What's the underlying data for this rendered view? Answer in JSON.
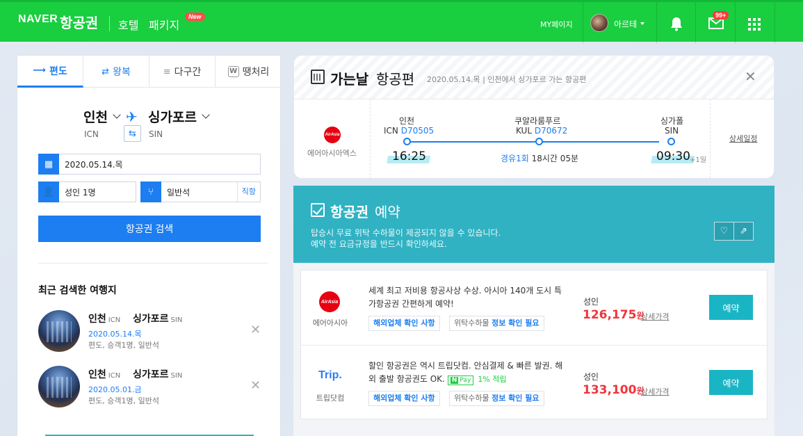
{
  "header": {
    "logo": "NAVER",
    "logo_sub": "항공권",
    "nav": [
      "호텔",
      "패키지"
    ],
    "new_badge": "New",
    "my_page": "MY페이지",
    "user_name": "아르테",
    "mail_badge": "99+"
  },
  "search": {
    "tabs": [
      "편도",
      "왕복",
      "다구간",
      "땡처리"
    ],
    "tab_icons": [
      "one-way-arrow-icon",
      "round-trip-arrow-icon",
      "multi-route-icon",
      "last-minute-icon"
    ],
    "from_city": "인천",
    "from_code": "ICN",
    "to_city": "싱가포르",
    "to_code": "SIN",
    "date": "2020.05.14.목",
    "passengers": "성인 1명",
    "seat_class": "일반석",
    "direct_label": "직항",
    "search_button": "항공권 검색",
    "w_icon_text": "W"
  },
  "recent": {
    "title": "최근 검색한 여행지",
    "items": [
      {
        "from": "인천",
        "from_code": "ICN",
        "to": "싱가포르",
        "to_code": "SIN",
        "date": "2020.05.14.목",
        "info": "편도, 승객1명, 일반석"
      },
      {
        "from": "인천",
        "from_code": "ICN",
        "to": "싱가포르",
        "to_code": "SIN",
        "date": "2020.05.01.금",
        "info": "편도, 승객1명, 일반석"
      }
    ]
  },
  "flight_card": {
    "title_bold": "가는날",
    "title_rest": "항공편",
    "subtitle": "2020.05.14.목 | 인천에서 싱가포르 가는 항공편",
    "airline_logo": "AirAsia",
    "airline": "에어아시아엑스",
    "origin": {
      "city": "인천",
      "code": "ICN",
      "flight": "D70505",
      "time": "16:25"
    },
    "transit": {
      "city": "쿠알라룸푸르",
      "code": "KUL",
      "flight": "D70672"
    },
    "destination": {
      "city": "싱가폴",
      "code": "SIN",
      "time": "09:30",
      "day_offset": "+1일"
    },
    "stops_label": "경유1회",
    "duration": "18시간 05분",
    "detail_link": "상세일정"
  },
  "booking": {
    "title_bold": "항공권",
    "title_rest": "예약",
    "desc1": "탑승시 무료 위탁 수하물이 제공되지 않을 수 있습니다.",
    "desc2": "예약 전 요금규정을 반드시 확인하세요.",
    "offers": [
      {
        "logo": "AirAsia",
        "name": "에어아시아",
        "desc": "세계 최고 저비용 항공사상 수상. 아시아 140개 도시 특가항공권 간편하게 예약!",
        "tag1": "해외업체 확인 사항",
        "tag2_prefix": "위탁수하물",
        "tag2_strong": "정보 확인 필요",
        "adult": "성인",
        "price": "126,175",
        "currency": "원",
        "detail": "상세가격",
        "book": "예약"
      },
      {
        "logo": "Trip.",
        "name": "트립닷컴",
        "desc": "할인 항공권은 역시 트립닷컴. 안심결제 & 빠른 발권. 해외 출발 항공권도 OK.",
        "npay_n": "N",
        "npay_label": "Pay",
        "earn": "1% 적립",
        "tag1": "해외업체 확인 사항",
        "tag2_prefix": "위탁수하물",
        "tag2_strong": "정보 확인 필요",
        "adult": "성인",
        "price": "133,100",
        "currency": "원",
        "detail": "상세가격",
        "book": "예약"
      }
    ]
  },
  "colors": {
    "naver_green": "#19ce3f",
    "primary_blue": "#1c7ef0",
    "teal": "#30b2c3",
    "price_red": "#f0353c"
  }
}
